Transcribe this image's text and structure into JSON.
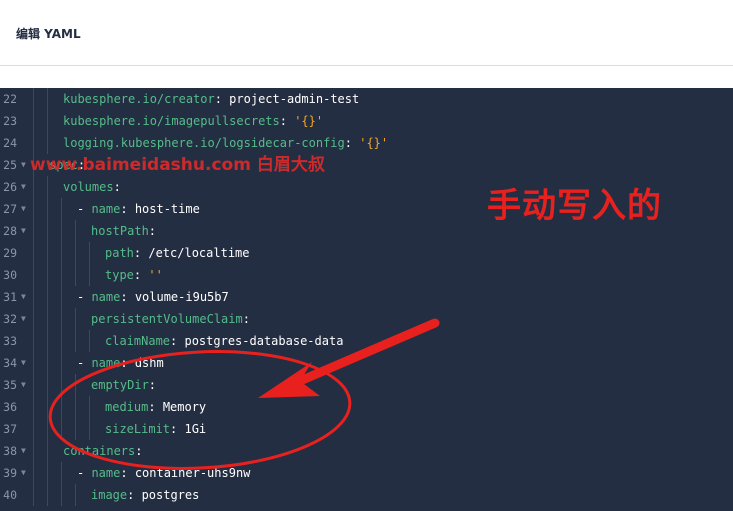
{
  "header": {
    "title": "编辑 YAML"
  },
  "editor": {
    "lines": [
      {
        "num": "22",
        "fold": false,
        "indent": 2,
        "key": "kubesphere.io/creator",
        "sep": ": ",
        "value": "project-admin-test",
        "vtype": "val"
      },
      {
        "num": "23",
        "fold": false,
        "indent": 2,
        "key": "kubesphere.io/imagepullsecrets",
        "sep": ": ",
        "value": "'{}'",
        "vtype": "str"
      },
      {
        "num": "24",
        "fold": false,
        "indent": 2,
        "key": "logging.kubesphere.io/logsidecar-config",
        "sep": ": ",
        "value": "'{}'",
        "vtype": "str"
      },
      {
        "num": "25",
        "fold": true,
        "indent": 1,
        "key": "spec",
        "sep": ":",
        "value": "",
        "vtype": "val"
      },
      {
        "num": "26",
        "fold": true,
        "indent": 2,
        "key": "volumes",
        "sep": ":",
        "value": "",
        "vtype": "val"
      },
      {
        "num": "27",
        "fold": true,
        "indent": 3,
        "dash": true,
        "key": "name",
        "sep": ": ",
        "value": "host-time",
        "vtype": "val"
      },
      {
        "num": "28",
        "fold": true,
        "indent": 4,
        "key": "hostPath",
        "sep": ":",
        "value": "",
        "vtype": "val"
      },
      {
        "num": "29",
        "fold": false,
        "indent": 5,
        "key": "path",
        "sep": ": ",
        "value": "/etc/localtime",
        "vtype": "val"
      },
      {
        "num": "30",
        "fold": false,
        "indent": 5,
        "key": "type",
        "sep": ": ",
        "value": "''",
        "vtype": "str"
      },
      {
        "num": "31",
        "fold": true,
        "indent": 3,
        "dash": true,
        "key": "name",
        "sep": ": ",
        "value": "volume-i9u5b7",
        "vtype": "val"
      },
      {
        "num": "32",
        "fold": true,
        "indent": 4,
        "key": "persistentVolumeClaim",
        "sep": ":",
        "value": "",
        "vtype": "val"
      },
      {
        "num": "33",
        "fold": false,
        "indent": 5,
        "key": "claimName",
        "sep": ": ",
        "value": "postgres-database-data",
        "vtype": "val"
      },
      {
        "num": "34",
        "fold": true,
        "indent": 3,
        "dash": true,
        "key": "name",
        "sep": ": ",
        "value": "dshm",
        "vtype": "val"
      },
      {
        "num": "35",
        "fold": true,
        "indent": 4,
        "key": "emptyDir",
        "sep": ":",
        "value": "",
        "vtype": "val"
      },
      {
        "num": "36",
        "fold": false,
        "indent": 5,
        "key": "medium",
        "sep": ": ",
        "value": "Memory",
        "vtype": "val"
      },
      {
        "num": "37",
        "fold": false,
        "indent": 5,
        "key": "sizeLimit",
        "sep": ": ",
        "value": "1Gi",
        "vtype": "val"
      },
      {
        "num": "38",
        "fold": true,
        "indent": 2,
        "key": "containers",
        "sep": ":",
        "value": "",
        "vtype": "val"
      },
      {
        "num": "39",
        "fold": true,
        "indent": 3,
        "dash": true,
        "key": "name",
        "sep": ": ",
        "value": "container-uhs9nw",
        "vtype": "val"
      },
      {
        "num": "40",
        "fold": false,
        "indent": 4,
        "key": "image",
        "sep": ": ",
        "value": "postgres",
        "vtype": "val"
      }
    ]
  },
  "annotations": {
    "watermark": "www.baimeidashu.com 白眉大叔",
    "callout": "手动写入的"
  },
  "colors": {
    "editor_bg": "#242e42",
    "key": "#55bc8a",
    "string": "#f5a623",
    "annotation_red": "#e8211f"
  }
}
